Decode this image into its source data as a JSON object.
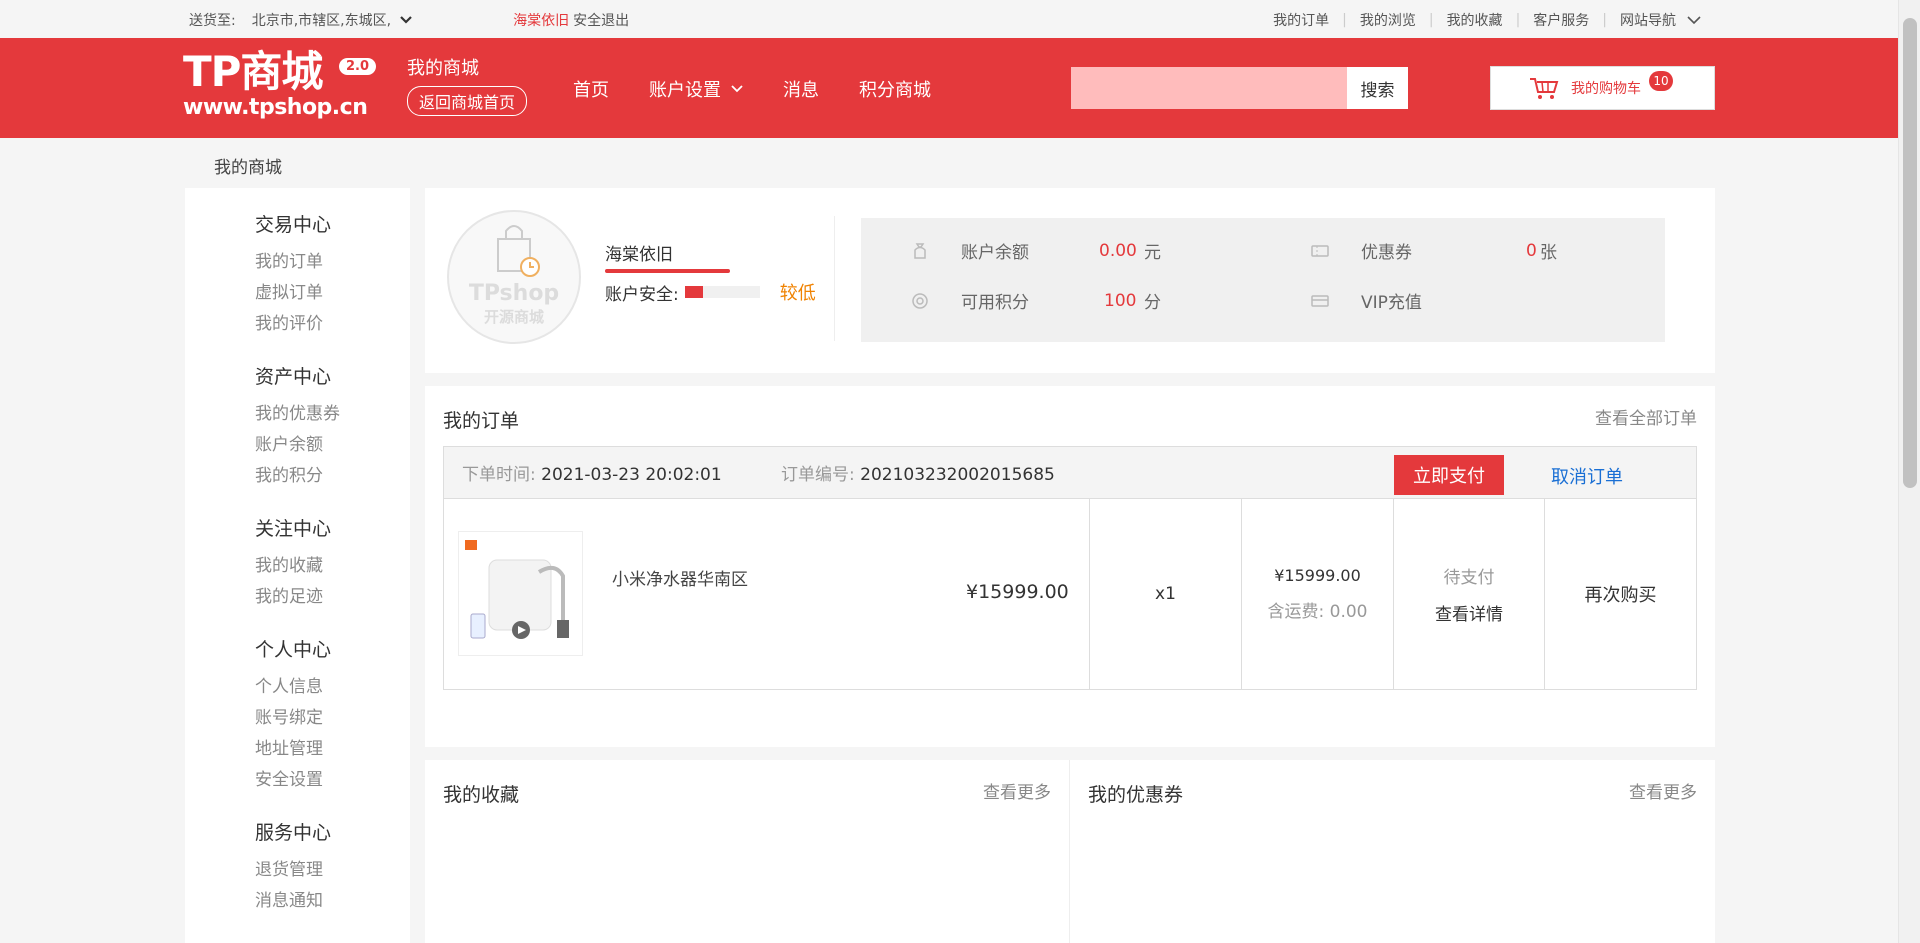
{
  "topbar": {
    "deliver_label": "送货至:",
    "location": "北京市,市辖区,东城区,",
    "username": "海棠依旧",
    "logout": "安全退出",
    "links": [
      "我的订单",
      "我的浏览",
      "我的收藏",
      "客户服务",
      "网站导航"
    ]
  },
  "header": {
    "logo_main": "TP商城",
    "logo_version": "2.0",
    "logo_url": "www.tpshop.cn",
    "my_mall": "我的商城",
    "back_home": "返回商城首页",
    "nav": [
      "首页",
      "账户设置",
      "消息",
      "积分商城"
    ],
    "search_placeholder": "",
    "search_button": "搜索",
    "cart_label": "我的购物车",
    "cart_count": "10"
  },
  "breadcrumb": "我的商城",
  "sidebar": {
    "groups": [
      {
        "title": "交易中心",
        "items": [
          "我的订单",
          "虚拟订单",
          "我的评价"
        ]
      },
      {
        "title": "资产中心",
        "items": [
          "我的优惠券",
          "账户余额",
          "我的积分"
        ]
      },
      {
        "title": "关注中心",
        "items": [
          "我的收藏",
          "我的足迹"
        ]
      },
      {
        "title": "个人中心",
        "items": [
          "个人信息",
          "账号绑定",
          "地址管理",
          "安全设置"
        ]
      },
      {
        "title": "服务中心",
        "items": [
          "退货管理",
          "消息通知"
        ]
      }
    ]
  },
  "profile": {
    "avatar_brand": "TPshop",
    "avatar_brand_sub": "开源商城",
    "username": "海棠依旧",
    "security_label": "账户安全:",
    "security_level": "较低",
    "security_fraction": 0.25,
    "stats": {
      "balance_label": "账户余额",
      "balance_value": "0.00",
      "balance_unit": "元",
      "coupon_label": "优惠券",
      "coupon_value": "0",
      "coupon_unit": "张",
      "points_label": "可用积分",
      "points_value": "100",
      "points_unit": "分",
      "vip_label": "VIP充值"
    }
  },
  "orders": {
    "title": "我的订单",
    "view_all": "查看全部订单",
    "order": {
      "time_label": "下单时间:",
      "time": "2021-03-23 20:02:01",
      "no_label": "订单编号:",
      "no": "202103232002015685",
      "pay_button": "立即支付",
      "cancel_button": "取消订单",
      "product_name": "小米净水器华南区",
      "price": "¥15999.00",
      "qty": "x1",
      "total": "¥15999.00",
      "shipping_label": "含运费:",
      "shipping": "0.00",
      "status": "待支付",
      "detail": "查看详情",
      "rebuy": "再次购买"
    }
  },
  "favorites": {
    "title": "我的收藏",
    "more": "查看更多"
  },
  "coupons": {
    "title": "我的优惠券",
    "more": "查看更多"
  }
}
